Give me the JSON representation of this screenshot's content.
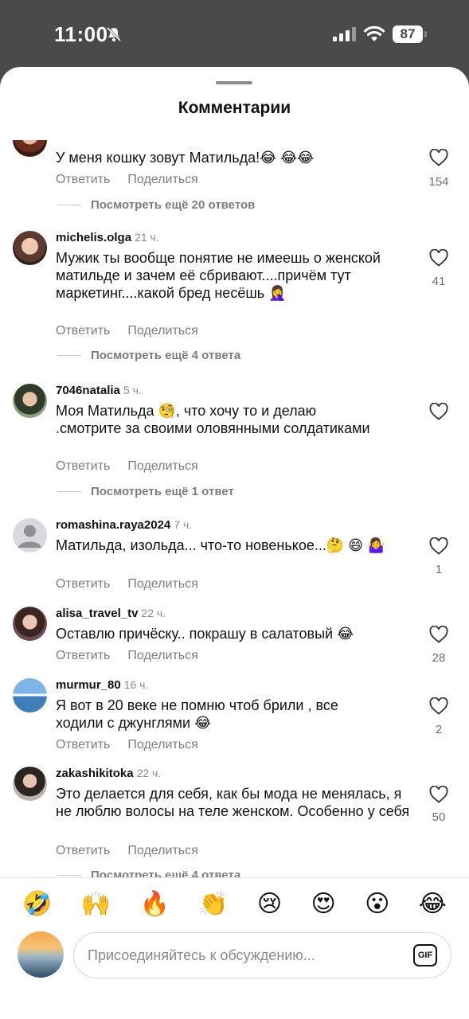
{
  "status_bar": {
    "time": "11:00",
    "battery": "87"
  },
  "sheet": {
    "title": "Комментарии"
  },
  "actions": {
    "reply": "Ответить",
    "share": "Поделиться"
  },
  "comments": [
    {
      "username": "",
      "ago": "",
      "text": "У меня кошку зовут Матильда!😂 😂😂",
      "likes": "154",
      "more": "Посмотреть ещё 20 ответов"
    },
    {
      "username": "michelis.olga",
      "ago": "21 ч.",
      "text": "Мужик ты вообще понятие не имеешь о женской матильде и зачем её сбривают....причём тут маркетинг....какой бред несёшь 🤦‍♀️",
      "likes": "41",
      "more": "Посмотреть ещё 4 ответа"
    },
    {
      "username": "7046natalia",
      "ago": "5 ч.",
      "text": "Моя Матильда 🧐, что хочу то и делаю .смотрите за своими оловянными солдатиками",
      "likes": "",
      "more": "Посмотреть ещё 1 ответ"
    },
    {
      "username": "romashina.raya2024",
      "ago": "7 ч.",
      "text": "Матильда, изольда... что-то новенькое...🤔 😄 🤷‍♀️",
      "likes": "1",
      "more": ""
    },
    {
      "username": "alisa_travel_tv",
      "ago": "22 ч.",
      "text": "Оставлю причёску.. покрашу в салатовый 😂",
      "likes": "28",
      "more": ""
    },
    {
      "username": "murmur_80",
      "ago": "16 ч.",
      "text": "Я вот в 20 веке не помню чтоб брили , все ходили с джунглями 😂",
      "likes": "2",
      "more": ""
    },
    {
      "username": "zakashikitoka",
      "ago": "22 ч.",
      "text": "Это делается для себя, как бы мода не менялась, я не люблю волосы на теле женском. Особенно у себя",
      "likes": "50",
      "more": "Посмотреть ещё 4 ответа"
    }
  ],
  "emoji_bar": [
    "🤣",
    "🙌",
    "🔥",
    "👏",
    "😢",
    "😍",
    "😮",
    "😂"
  ],
  "composer": {
    "placeholder": "Присоединяйтесь к обсуждению...",
    "gif": "GIF"
  },
  "colors": {
    "sheet_bg": "#ffffff",
    "backdrop": "#4a4a4a",
    "muted": "#7d7d7d"
  }
}
